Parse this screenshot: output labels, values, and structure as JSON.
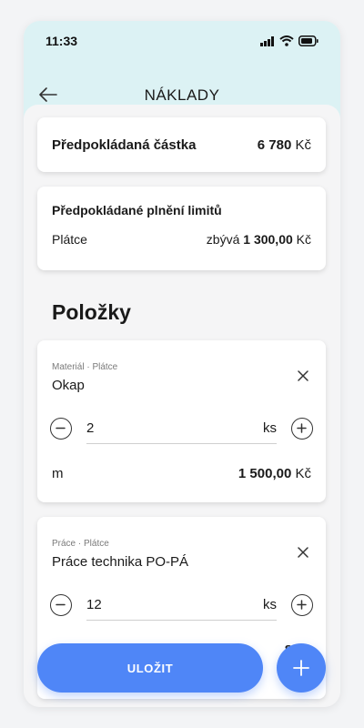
{
  "status_bar": {
    "time": "11:33"
  },
  "header": {
    "title": "NÁKLADY"
  },
  "summary": {
    "label": "Předpokládaná částka",
    "amount": "6 780",
    "currency": "Kč"
  },
  "limits": {
    "title": "Předpokládané plnění limitů",
    "payer_label": "Plátce",
    "remaining_prefix": "zbývá",
    "remaining_amount": "1 300,00",
    "currency": "Kč"
  },
  "section": {
    "title": "Položky"
  },
  "items": [
    {
      "meta": "Materiál · Plátce",
      "name": "Okap",
      "quantity": "2",
      "unit": "ks",
      "price_unit": "m",
      "price": "1 500,00",
      "currency": "Kč"
    },
    {
      "meta": "Práce · Plátce",
      "name": "Práce technika PO-PÁ",
      "quantity": "12",
      "unit": "ks",
      "price_partial": "80,0"
    }
  ],
  "actions": {
    "save_label": "ULOŽIT"
  },
  "icons": {
    "back": "arrow-left-icon",
    "close": "close-icon",
    "minus": "minus-circle-icon",
    "plus": "plus-circle-icon",
    "add": "plus-icon",
    "signal": "signal-icon",
    "wifi": "wifi-icon",
    "battery": "battery-icon"
  },
  "colors": {
    "accent": "#4f86f7",
    "header_bg": "#dcf2f4"
  }
}
